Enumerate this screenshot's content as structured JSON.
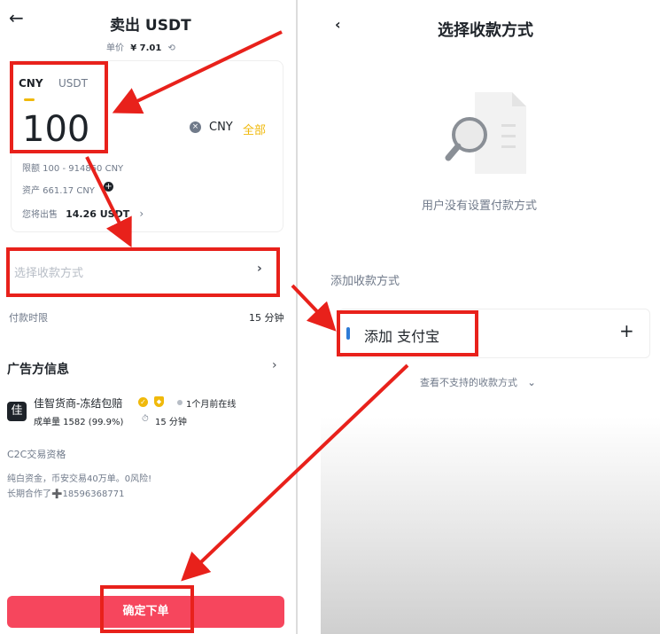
{
  "left": {
    "header": {
      "back_icon": "←",
      "title": "卖出 USDT"
    },
    "price": {
      "label": "单价",
      "value": "¥ 7.01",
      "refresh_icon": "⟲"
    },
    "amount_card": {
      "tabs": [
        "CNY",
        "USDT"
      ],
      "active_tab": 0,
      "amount": "100",
      "clear_icon": "×",
      "currency": "CNY",
      "all_label": "全部",
      "limit_text": "限额 100 - 914860 CNY",
      "asset_text": "资产 661.17 CNY",
      "sell_label": "您将出售",
      "sell_value": "14.26 USDT",
      "sell_chevron": "›"
    },
    "payment_select": {
      "placeholder": "选择收款方式",
      "chevron": "›"
    },
    "payment_time": {
      "label": "付款时限",
      "value": "15 分钟"
    },
    "advertiser": {
      "section_title": "广告方信息",
      "chevron": "›",
      "avatar_char": "佳",
      "name": "佳智货商-冻结包赔",
      "online_status": "1个月前在线",
      "orders_label": "成单量 1582 (99.9%)",
      "time_label": "15 分钟",
      "qualification_title": "C2C交易资格",
      "desc_line1": "纯白资金，币安交易40万单。0风险!",
      "desc_line2": "长期合作了➕18596368771"
    },
    "confirm_button": "确定下单"
  },
  "right": {
    "header": {
      "back_icon": "‹",
      "title": "选择收款方式"
    },
    "empty_text": "用户没有设置付款方式",
    "add_section_label": "添加收款方式",
    "alipay": {
      "label": "添加 支付宝",
      "plus": "+"
    },
    "unsupported": {
      "label": "查看不支持的收款方式",
      "chevron": "⌄"
    }
  },
  "colors": {
    "accent": "#f0b90b",
    "sell": "#f6465d",
    "annotation": "#e8211b",
    "alipay_blue": "#2e7bd6"
  }
}
